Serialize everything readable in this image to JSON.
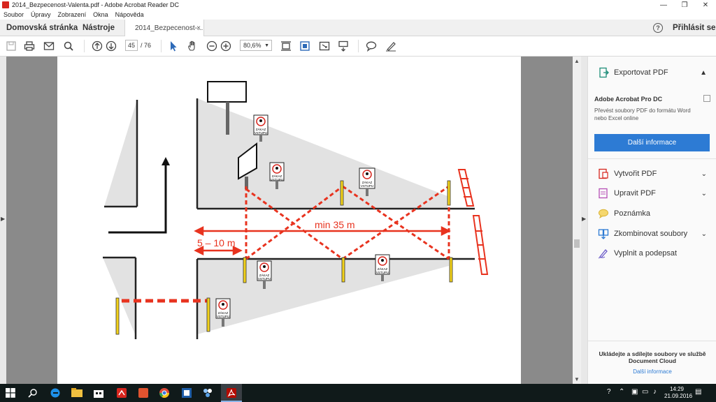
{
  "window": {
    "title": "2014_Bezpecenost-Valenta.pdf - Adobe Acrobat Reader DC",
    "minimize": "—",
    "restore": "❐",
    "close": "✕"
  },
  "menu": [
    "Soubor",
    "Úpravy",
    "Zobrazení",
    "Okna",
    "Nápověda"
  ],
  "tabs": {
    "home": "Domovská stránka",
    "tools": "Nástroje",
    "document": "2014_Bezpecenost-...",
    "close": "×"
  },
  "header": {
    "help": "?",
    "signin": "Přihlásit se"
  },
  "toolbar": {
    "page_current": "45",
    "page_total": "/ 76",
    "zoom": "80,6%",
    "icons": [
      "save-icon",
      "print-icon",
      "email-icon",
      "search-icon",
      "page-up-icon",
      "page-down-icon",
      "select-icon",
      "hand-icon",
      "zoom-out-icon",
      "zoom-in-icon",
      "fit-page-icon",
      "crop-icon",
      "fullscreen-icon",
      "scroll-mode-icon",
      "comment-icon",
      "sign-icon"
    ]
  },
  "document": {
    "labels": {
      "min_distance": "min 35 m",
      "entry_distance": "5 – 10 m",
      "sign_line1": "ZÁKAZ",
      "sign_line2": "VSTUPU"
    }
  },
  "panel": {
    "export": "Exportovat PDF",
    "acrobat_title": "Adobe Acrobat Pro DC",
    "acrobat_desc": "Převést soubory PDF do formátu Word nebo Excel online",
    "more_info_button": "Další informace",
    "create": "Vytvořit PDF",
    "edit": "Upravit PDF",
    "note": "Poznámka",
    "combine": "Zkombinovat soubory",
    "fill_sign": "Vyplnit a podepsat",
    "cloud_text": "Ukládejte a sdílejte soubory ve službě Document Cloud",
    "cloud_link": "Další informace"
  },
  "taskbar": {
    "time": "14:29",
    "date": "21.09.2016"
  },
  "colors": {
    "accent_blue": "#2d7bd4",
    "barrier_red": "#e8331f",
    "taskbar": "#101a1a"
  }
}
